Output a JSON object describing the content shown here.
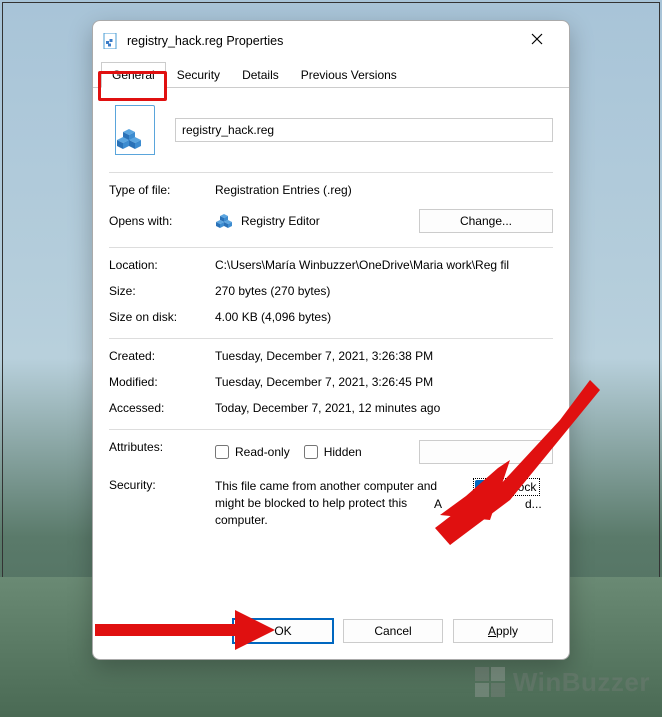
{
  "title": "registry_hack.reg Properties",
  "tabs": [
    {
      "label": "General",
      "active": true
    },
    {
      "label": "Security",
      "active": false
    },
    {
      "label": "Details",
      "active": false
    },
    {
      "label": "Previous Versions",
      "active": false
    }
  ],
  "filename": "registry_hack.reg",
  "rows": {
    "type_label": "Type of file:",
    "type_value": "Registration Entries (.reg)",
    "opens_label": "Opens with:",
    "opens_value": "Registry Editor",
    "change_label": "Change...",
    "location_label": "Location:",
    "location_value": "C:\\Users\\María Winbuzzer\\OneDrive\\Maria work\\Reg fil",
    "size_label": "Size:",
    "size_value": "270 bytes (270 bytes)",
    "disk_label": "Size on disk:",
    "disk_value": "4.00 KB (4,096 bytes)",
    "created_label": "Created:",
    "created_value": "Tuesday, December 7, 2021, 3:26:38 PM",
    "modified_label": "Modified:",
    "modified_value": "Tuesday, December 7, 2021, 3:26:45 PM",
    "accessed_label": "Accessed:",
    "accessed_value": "Today, December 7, 2021, 12 minutes ago"
  },
  "attributes": {
    "label": "Attributes:",
    "readonly_label": "Read-only",
    "hidden_label": "Hidden",
    "advanced_label": "Advanced..."
  },
  "security": {
    "label": "Security:",
    "text": "This file came from another computer and might be blocked to help protect this computer.",
    "unblock_label": "Unblock",
    "unblock_checked": true
  },
  "buttons": {
    "ok": "OK",
    "cancel": "Cancel",
    "apply": "Apply"
  },
  "watermark": "WinBuzzer"
}
